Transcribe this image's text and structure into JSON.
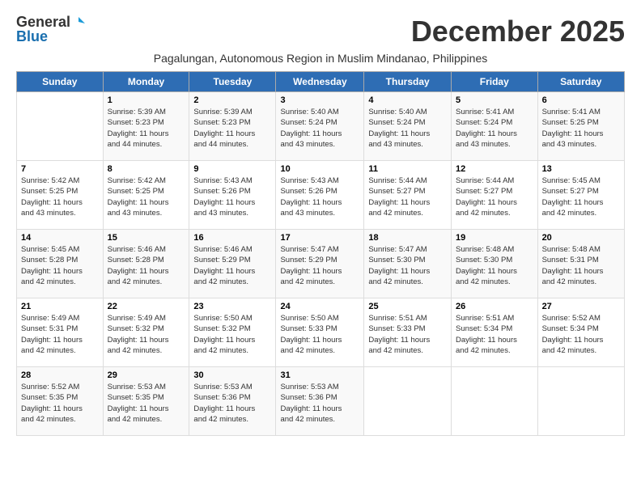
{
  "logo": {
    "general": "General",
    "blue": "Blue"
  },
  "title": "December 2025",
  "subtitle": "Pagalungan, Autonomous Region in Muslim Mindanao, Philippines",
  "days_of_week": [
    "Sunday",
    "Monday",
    "Tuesday",
    "Wednesday",
    "Thursday",
    "Friday",
    "Saturday"
  ],
  "weeks": [
    [
      {
        "day": "",
        "info": ""
      },
      {
        "day": "1",
        "info": "Sunrise: 5:39 AM\nSunset: 5:23 PM\nDaylight: 11 hours\nand 44 minutes."
      },
      {
        "day": "2",
        "info": "Sunrise: 5:39 AM\nSunset: 5:23 PM\nDaylight: 11 hours\nand 44 minutes."
      },
      {
        "day": "3",
        "info": "Sunrise: 5:40 AM\nSunset: 5:24 PM\nDaylight: 11 hours\nand 43 minutes."
      },
      {
        "day": "4",
        "info": "Sunrise: 5:40 AM\nSunset: 5:24 PM\nDaylight: 11 hours\nand 43 minutes."
      },
      {
        "day": "5",
        "info": "Sunrise: 5:41 AM\nSunset: 5:24 PM\nDaylight: 11 hours\nand 43 minutes."
      },
      {
        "day": "6",
        "info": "Sunrise: 5:41 AM\nSunset: 5:25 PM\nDaylight: 11 hours\nand 43 minutes."
      }
    ],
    [
      {
        "day": "7",
        "info": "Sunrise: 5:42 AM\nSunset: 5:25 PM\nDaylight: 11 hours\nand 43 minutes."
      },
      {
        "day": "8",
        "info": "Sunrise: 5:42 AM\nSunset: 5:25 PM\nDaylight: 11 hours\nand 43 minutes."
      },
      {
        "day": "9",
        "info": "Sunrise: 5:43 AM\nSunset: 5:26 PM\nDaylight: 11 hours\nand 43 minutes."
      },
      {
        "day": "10",
        "info": "Sunrise: 5:43 AM\nSunset: 5:26 PM\nDaylight: 11 hours\nand 43 minutes."
      },
      {
        "day": "11",
        "info": "Sunrise: 5:44 AM\nSunset: 5:27 PM\nDaylight: 11 hours\nand 42 minutes."
      },
      {
        "day": "12",
        "info": "Sunrise: 5:44 AM\nSunset: 5:27 PM\nDaylight: 11 hours\nand 42 minutes."
      },
      {
        "day": "13",
        "info": "Sunrise: 5:45 AM\nSunset: 5:27 PM\nDaylight: 11 hours\nand 42 minutes."
      }
    ],
    [
      {
        "day": "14",
        "info": "Sunrise: 5:45 AM\nSunset: 5:28 PM\nDaylight: 11 hours\nand 42 minutes."
      },
      {
        "day": "15",
        "info": "Sunrise: 5:46 AM\nSunset: 5:28 PM\nDaylight: 11 hours\nand 42 minutes."
      },
      {
        "day": "16",
        "info": "Sunrise: 5:46 AM\nSunset: 5:29 PM\nDaylight: 11 hours\nand 42 minutes."
      },
      {
        "day": "17",
        "info": "Sunrise: 5:47 AM\nSunset: 5:29 PM\nDaylight: 11 hours\nand 42 minutes."
      },
      {
        "day": "18",
        "info": "Sunrise: 5:47 AM\nSunset: 5:30 PM\nDaylight: 11 hours\nand 42 minutes."
      },
      {
        "day": "19",
        "info": "Sunrise: 5:48 AM\nSunset: 5:30 PM\nDaylight: 11 hours\nand 42 minutes."
      },
      {
        "day": "20",
        "info": "Sunrise: 5:48 AM\nSunset: 5:31 PM\nDaylight: 11 hours\nand 42 minutes."
      }
    ],
    [
      {
        "day": "21",
        "info": "Sunrise: 5:49 AM\nSunset: 5:31 PM\nDaylight: 11 hours\nand 42 minutes."
      },
      {
        "day": "22",
        "info": "Sunrise: 5:49 AM\nSunset: 5:32 PM\nDaylight: 11 hours\nand 42 minutes."
      },
      {
        "day": "23",
        "info": "Sunrise: 5:50 AM\nSunset: 5:32 PM\nDaylight: 11 hours\nand 42 minutes."
      },
      {
        "day": "24",
        "info": "Sunrise: 5:50 AM\nSunset: 5:33 PM\nDaylight: 11 hours\nand 42 minutes."
      },
      {
        "day": "25",
        "info": "Sunrise: 5:51 AM\nSunset: 5:33 PM\nDaylight: 11 hours\nand 42 minutes."
      },
      {
        "day": "26",
        "info": "Sunrise: 5:51 AM\nSunset: 5:34 PM\nDaylight: 11 hours\nand 42 minutes."
      },
      {
        "day": "27",
        "info": "Sunrise: 5:52 AM\nSunset: 5:34 PM\nDaylight: 11 hours\nand 42 minutes."
      }
    ],
    [
      {
        "day": "28",
        "info": "Sunrise: 5:52 AM\nSunset: 5:35 PM\nDaylight: 11 hours\nand 42 minutes."
      },
      {
        "day": "29",
        "info": "Sunrise: 5:53 AM\nSunset: 5:35 PM\nDaylight: 11 hours\nand 42 minutes."
      },
      {
        "day": "30",
        "info": "Sunrise: 5:53 AM\nSunset: 5:36 PM\nDaylight: 11 hours\nand 42 minutes."
      },
      {
        "day": "31",
        "info": "Sunrise: 5:53 AM\nSunset: 5:36 PM\nDaylight: 11 hours\nand 42 minutes."
      },
      {
        "day": "",
        "info": ""
      },
      {
        "day": "",
        "info": ""
      },
      {
        "day": "",
        "info": ""
      }
    ]
  ]
}
